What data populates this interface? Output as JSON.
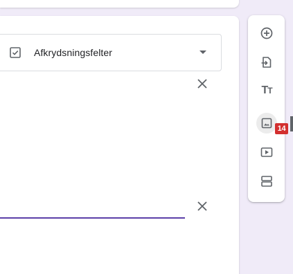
{
  "question": {
    "type_select": {
      "icon": "checkbox-icon",
      "value": "Afkrydsningsfelter"
    },
    "close_icon": "close-icon"
  },
  "toolbar": {
    "items": [
      {
        "name": "add-question",
        "icon": "add-circle-icon"
      },
      {
        "name": "import-questions",
        "icon": "import-icon"
      },
      {
        "name": "add-title",
        "icon": "title-icon",
        "glyph": "T",
        "glyph_small": "T"
      },
      {
        "name": "add-image",
        "icon": "image-icon"
      },
      {
        "name": "add-video",
        "icon": "video-icon"
      },
      {
        "name": "add-section",
        "icon": "section-icon"
      }
    ],
    "badge": "14"
  },
  "colors": {
    "background": "#f0ebf8",
    "accent": "#5b3fa8",
    "icon": "#5f6368",
    "badge": "#d32f2f"
  }
}
